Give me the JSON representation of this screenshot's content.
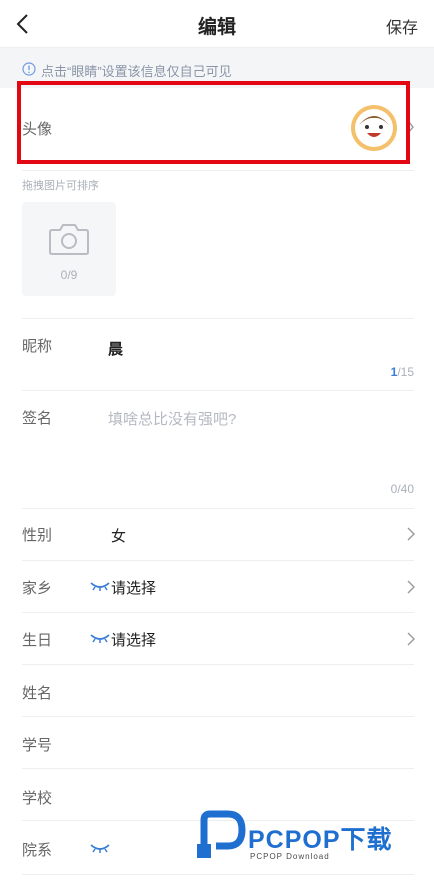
{
  "header": {
    "title": "编辑",
    "save_label": "保存"
  },
  "tip": {
    "text": "点击“眼睛”设置该信息仅自己可见"
  },
  "avatar": {
    "label": "头像"
  },
  "photos": {
    "sort_tip": "拖拽图片可排序",
    "count": "0/9"
  },
  "nickname": {
    "label": "昵称",
    "value": "晨",
    "count_current": "1",
    "count_total": "/15"
  },
  "signature": {
    "label": "签名",
    "placeholder": "填啥总比没有强吧?",
    "count": "0/40"
  },
  "gender": {
    "label": "性别",
    "value": "女"
  },
  "hometown": {
    "label": "家乡",
    "value": "请选择"
  },
  "birthday": {
    "label": "生日",
    "value": "请选择"
  },
  "name": {
    "label": "姓名"
  },
  "student_id": {
    "label": "学号"
  },
  "school": {
    "label": "学校"
  },
  "department": {
    "label": "院系"
  },
  "watermark": {
    "brand": "PCPOP下载",
    "sub": "PCPOP Download"
  },
  "colors": {
    "accent": "#3a7dd8",
    "highlight": "#e30613",
    "avatar_bg": "#f4c06b"
  }
}
